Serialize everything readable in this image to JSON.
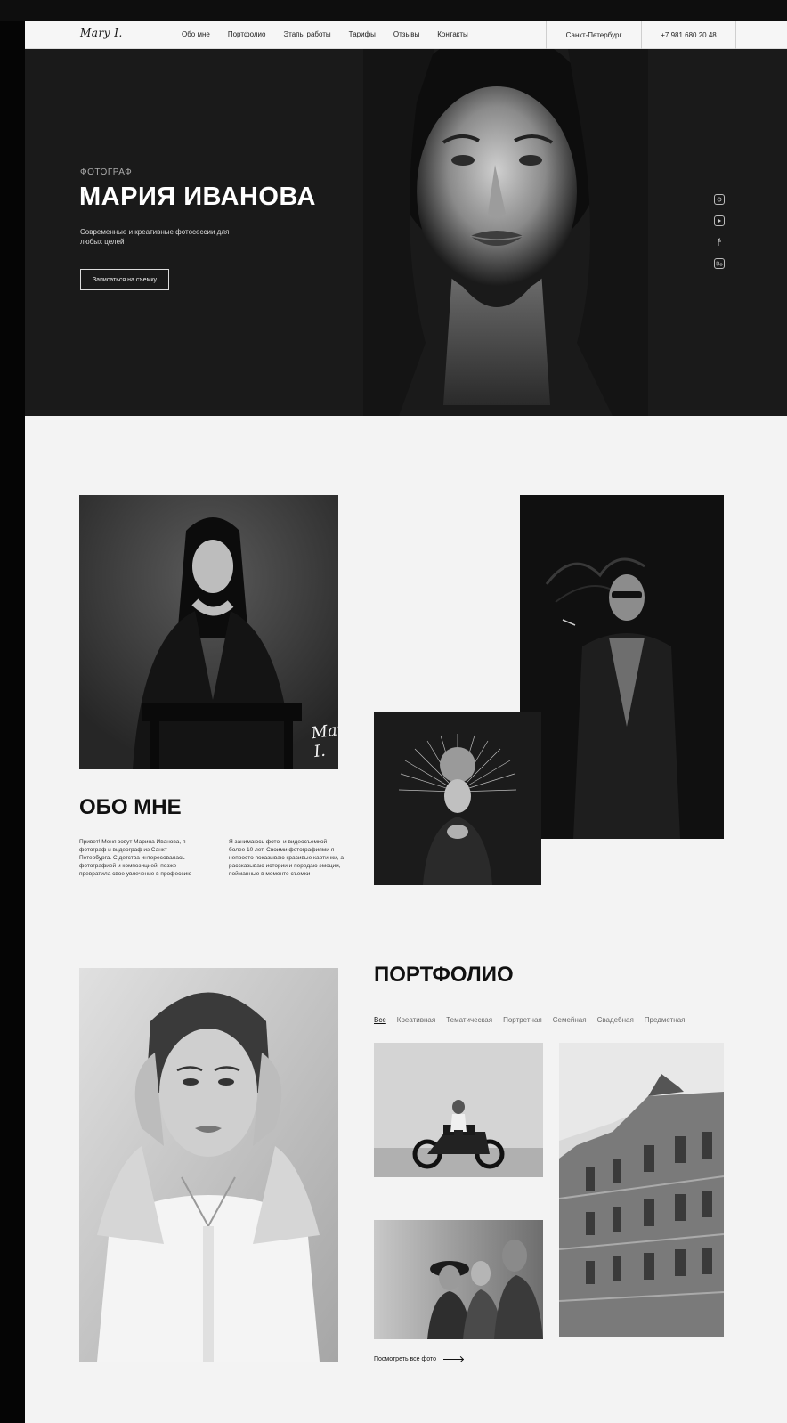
{
  "header": {
    "logo": "Mary I.",
    "nav": [
      "Обо мне",
      "Портфолио",
      "Этапы работы",
      "Тарифы",
      "Отзывы",
      "Контакты"
    ],
    "city": "Санкт-Петербург",
    "phone": "+7 981 680 20 48"
  },
  "hero": {
    "eyebrow": "ФОТОГРАФ",
    "title": "МАРИЯ ИВАНОВА",
    "subtitle": "Современные и креативные фотосессии для любых целей",
    "cta": "Записаться на съемку",
    "socials": [
      "instagram-icon",
      "youtube-icon",
      "facebook-icon",
      "behance-icon"
    ]
  },
  "about": {
    "signature": "Mary I.",
    "title": "ОБО МНЕ",
    "text1": "Привет! Меня зовут Марина Иванова, я фотограф и видеограф из Санкт-Петербурга. С детства интересовалась фотографией и композицией, позже превратила свое увлечение в профессию",
    "text2": "Я занимаюсь фото- и видеосъемкой более 10 лет. Своими фотографиями я непросто показываю красивые картинки, а рассказываю истории и передаю эмоции, пойманные в моменте съемки"
  },
  "portfolio": {
    "title": "ПОРТФОЛИО",
    "filters": [
      "Все",
      "Креативная",
      "Тематическая",
      "Портретная",
      "Семейная",
      "Свадебная",
      "Предметная"
    ],
    "see_all": "Посмотреть все фото"
  }
}
